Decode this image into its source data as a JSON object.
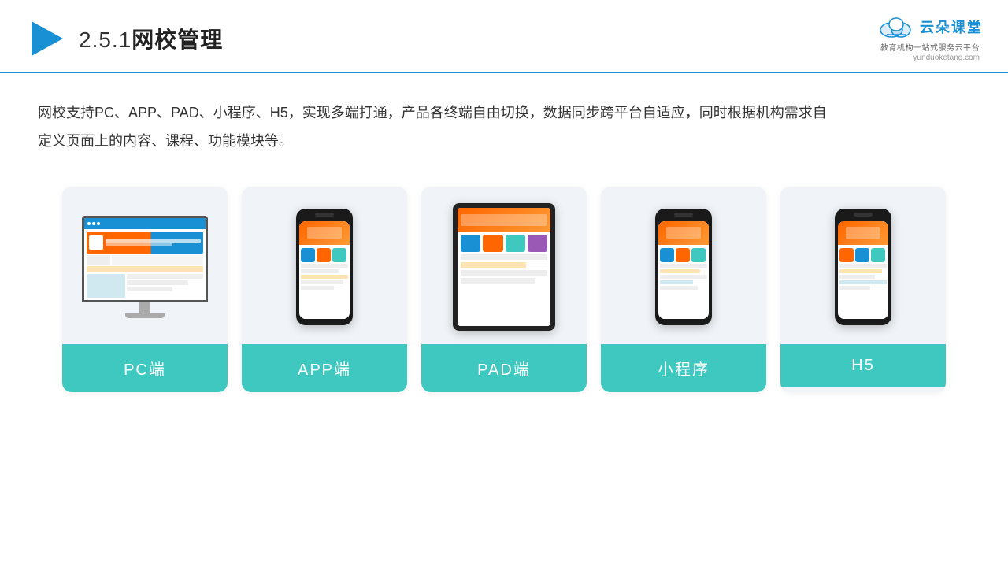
{
  "header": {
    "title": "2.5.1网校管理",
    "title_prefix": "2.5.1",
    "title_main": "网校管理"
  },
  "logo": {
    "name": "云朵课堂",
    "url": "yunduoketang.com",
    "slogan_line1": "教育机构一站",
    "slogan_line2": "式服务云平台"
  },
  "description": "网校支持PC、APP、PAD、小程序、H5，实现多端打通，产品各终端自由切换，数据同步跨平台自适应，同时根据机构需求自定义页面上的内容、课程、功能模块等。",
  "cards": [
    {
      "id": "pc",
      "label": "PC端"
    },
    {
      "id": "app",
      "label": "APP端"
    },
    {
      "id": "pad",
      "label": "PAD端"
    },
    {
      "id": "miniapp",
      "label": "小程序"
    },
    {
      "id": "h5",
      "label": "H5"
    }
  ]
}
